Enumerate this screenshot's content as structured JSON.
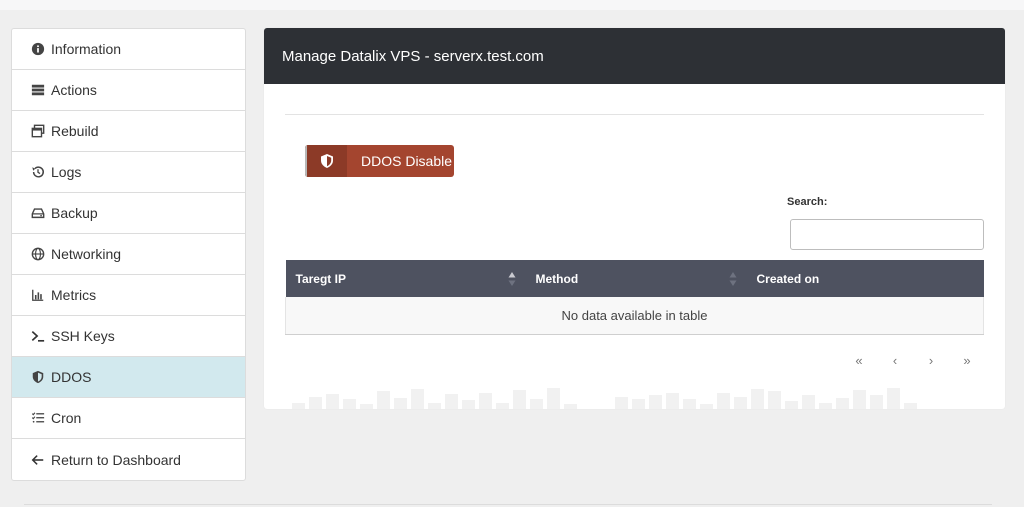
{
  "sidebar": {
    "items": [
      {
        "label": "Information",
        "icon": "info-circle-icon"
      },
      {
        "label": "Actions",
        "icon": "server-icon"
      },
      {
        "label": "Rebuild",
        "icon": "windows-icon"
      },
      {
        "label": "Logs",
        "icon": "history-icon"
      },
      {
        "label": "Backup",
        "icon": "hdd-icon"
      },
      {
        "label": "Networking",
        "icon": "globe-icon"
      },
      {
        "label": "Metrics",
        "icon": "chart-icon"
      },
      {
        "label": "SSH Keys",
        "icon": "terminal-icon"
      },
      {
        "label": "DDOS",
        "icon": "shield-icon",
        "active": true
      },
      {
        "label": "Cron",
        "icon": "task-list-icon"
      },
      {
        "label": "Return to Dashboard",
        "icon": "arrow-left-icon"
      }
    ]
  },
  "panel": {
    "title": "Manage Datalix VPS - serverx.test.com",
    "ddos_button_label": "DDOS Disable",
    "search_label": "Search:",
    "search_value": "",
    "table": {
      "columns": [
        "Taregt IP",
        "Method",
        "Created on"
      ],
      "empty_message": "No data available in table"
    },
    "pagination": [
      "«",
      "‹",
      "›",
      "»"
    ]
  },
  "colors": {
    "header_bg": "#2d3035",
    "table_header_bg": "#4e5260",
    "ddos_button": "#a4452f",
    "active_nav": "#d2e9ee"
  }
}
